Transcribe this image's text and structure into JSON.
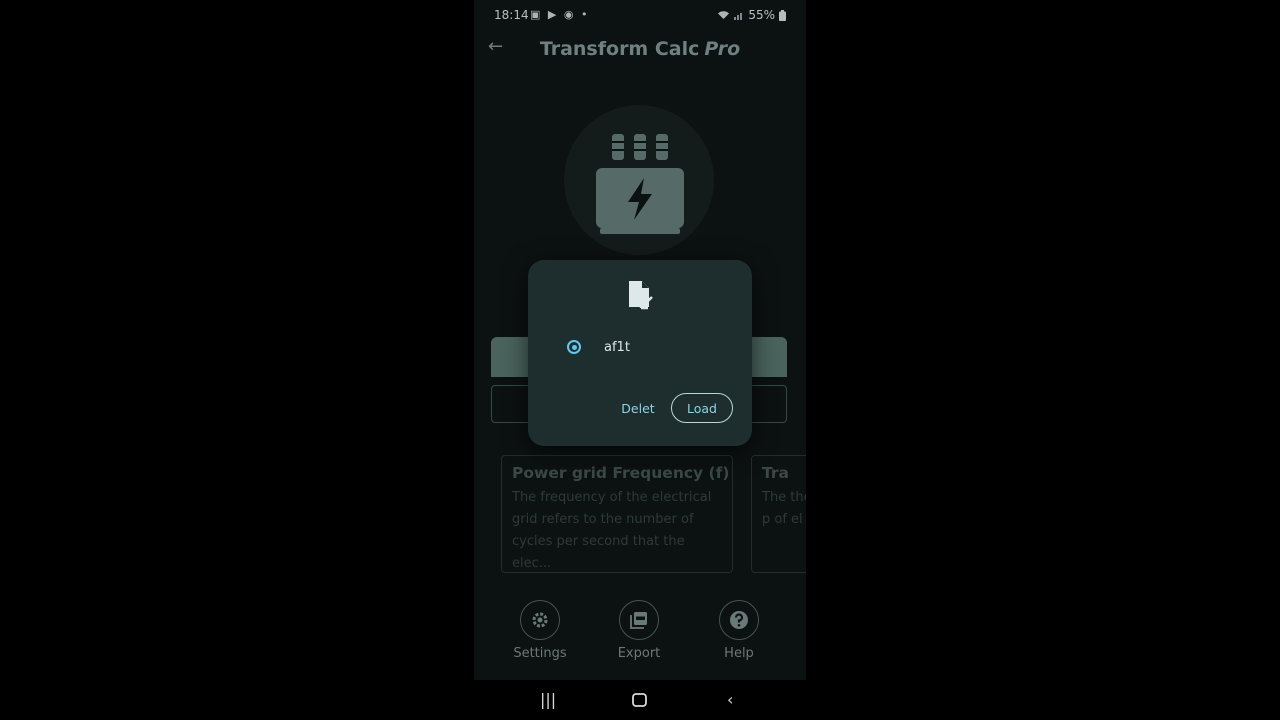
{
  "status_bar": {
    "time": "18:14",
    "notification_icons": "▣ ▶ ◉ •",
    "wifi_icon": "wifi-icon",
    "signal_icon": "signal-icon",
    "battery": "55%"
  },
  "app_bar": {
    "title": "Transform Calc",
    "title_suffix": "Pro",
    "back_icon": "arrow-left-icon"
  },
  "cards": [
    {
      "title": "Power grid Frequency (f)",
      "body": "The frequency of the electrical grid refers to the number of cycles per second that the elec..."
    },
    {
      "title": "Tra",
      "body": "The the p of el"
    }
  ],
  "bottom_nav": [
    {
      "label": "Settings",
      "icon": "gear-icon"
    },
    {
      "label": "Export",
      "icon": "pdf-icon"
    },
    {
      "label": "Help",
      "icon": "help-icon"
    }
  ],
  "dialog": {
    "icon": "file-import-icon",
    "options": [
      {
        "label": "af1t",
        "selected": true
      }
    ],
    "delete_label": "Delet",
    "load_label": "Load"
  },
  "colors": {
    "accent": "#62c7f0",
    "background": "#101717",
    "dialog_bg": "#1e2d2d",
    "primary_green": "#5f7f78"
  }
}
